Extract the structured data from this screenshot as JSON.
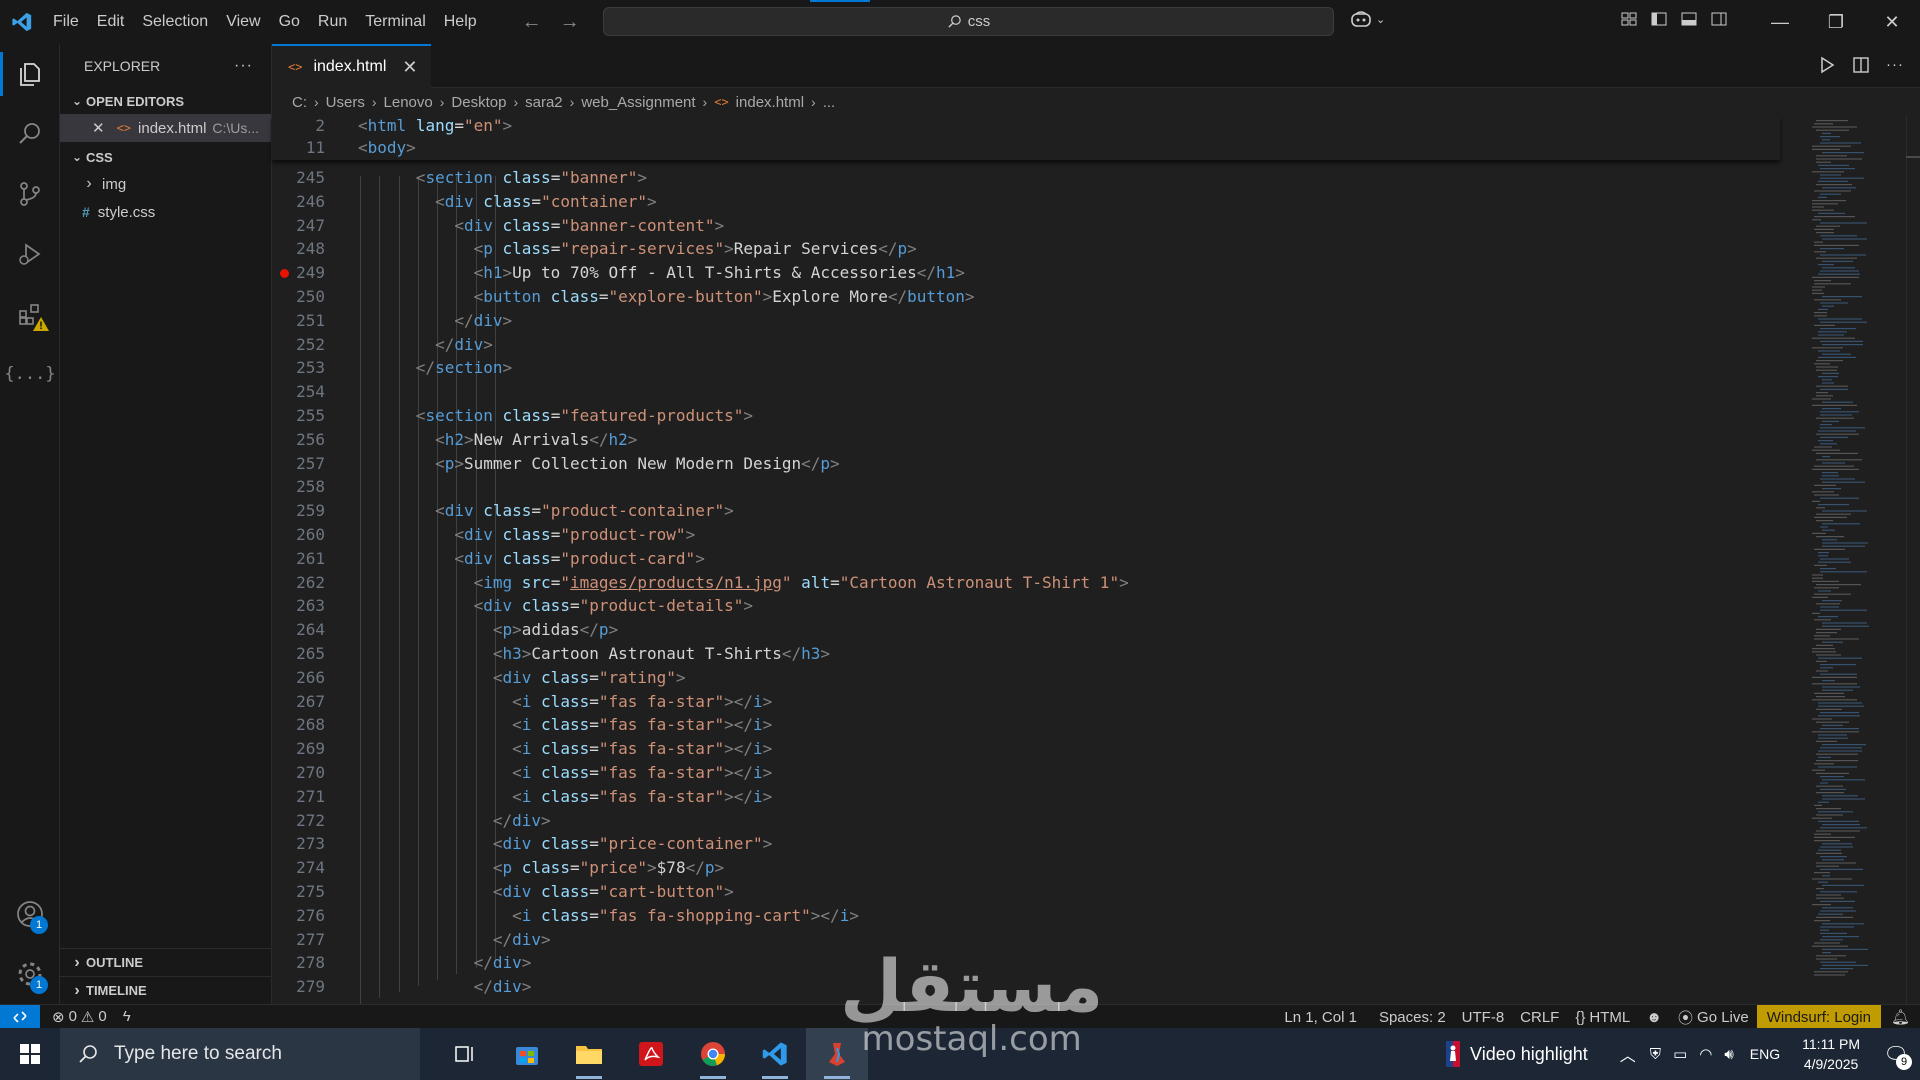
{
  "menu": [
    "File",
    "Edit",
    "Selection",
    "View",
    "Go",
    "Run",
    "Terminal",
    "Help"
  ],
  "command_center": {
    "text": "css"
  },
  "sidebar": {
    "title": "EXPLORER",
    "more": "···",
    "open_editors_label": "OPEN EDITORS",
    "open_editor": {
      "name": "index.html",
      "path": "C:\\Us..."
    },
    "folder_label": "CSS",
    "tree": [
      {
        "name": "img",
        "type": "folder"
      },
      {
        "name": "style.css",
        "type": "css"
      }
    ],
    "outline_label": "OUTLINE",
    "timeline_label": "TIMELINE"
  },
  "tab": {
    "label": "index.html"
  },
  "breadcrumb": [
    "C:",
    "Users",
    "Lenovo",
    "Desktop",
    "sara2",
    "web_Assignment",
    "index.html",
    "..."
  ],
  "sticky_lines": [
    {
      "n": "2",
      "code": "<html lang=\"en\">"
    },
    {
      "n": "11",
      "code": "<body>"
    }
  ],
  "code_lines": [
    {
      "n": "245",
      "code": "      <section class=\"banner\">"
    },
    {
      "n": "246",
      "code": "        <div class=\"container\">"
    },
    {
      "n": "247",
      "code": "          <div class=\"banner-content\">"
    },
    {
      "n": "248",
      "code": "            <p class=\"repair-services\">Repair Services</p>"
    },
    {
      "n": "249",
      "code": "            <h1>Up to 70% Off - All T-Shirts & Accessories</h1>",
      "breakpoint": true
    },
    {
      "n": "250",
      "code": "            <button class=\"explore-button\">Explore More</button>"
    },
    {
      "n": "251",
      "code": "          </div>"
    },
    {
      "n": "252",
      "code": "        </div>"
    },
    {
      "n": "253",
      "code": "      </section>"
    },
    {
      "n": "254",
      "code": ""
    },
    {
      "n": "255",
      "code": "      <section class=\"featured-products\">"
    },
    {
      "n": "256",
      "code": "        <h2>New Arrivals</h2>"
    },
    {
      "n": "257",
      "code": "        <p>Summer Collection New Modern Design</p>"
    },
    {
      "n": "258",
      "code": ""
    },
    {
      "n": "259",
      "code": "        <div class=\"product-container\">"
    },
    {
      "n": "260",
      "code": "          <div class=\"product-row\">"
    },
    {
      "n": "261",
      "code": "          <div class=\"product-card\">"
    },
    {
      "n": "262",
      "code": "            <img src=\"images/products/n1.jpg\" alt=\"Cartoon Astronaut T-Shirt 1\">"
    },
    {
      "n": "263",
      "code": "            <div class=\"product-details\">"
    },
    {
      "n": "264",
      "code": "              <p>adidas</p>"
    },
    {
      "n": "265",
      "code": "              <h3>Cartoon Astronaut T-Shirts</h3>"
    },
    {
      "n": "266",
      "code": "              <div class=\"rating\">"
    },
    {
      "n": "267",
      "code": "                <i class=\"fas fa-star\"></i>"
    },
    {
      "n": "268",
      "code": "                <i class=\"fas fa-star\"></i>"
    },
    {
      "n": "269",
      "code": "                <i class=\"fas fa-star\"></i>"
    },
    {
      "n": "270",
      "code": "                <i class=\"fas fa-star\"></i>"
    },
    {
      "n": "271",
      "code": "                <i class=\"fas fa-star\"></i>"
    },
    {
      "n": "272",
      "code": "              </div>"
    },
    {
      "n": "273",
      "code": "              <div class=\"price-container\">"
    },
    {
      "n": "274",
      "code": "              <p class=\"price\">$78</p>"
    },
    {
      "n": "275",
      "code": "              <div class=\"cart-button\">"
    },
    {
      "n": "276",
      "code": "                <i class=\"fas fa-shopping-cart\"></i>"
    },
    {
      "n": "277",
      "code": "              </div>"
    },
    {
      "n": "278",
      "code": "            </div>"
    },
    {
      "n": "279",
      "code": "            </div>"
    }
  ],
  "status": {
    "errors": "0",
    "warnings": "0",
    "position": "Ln 1, Col 1",
    "spaces": "Spaces: 2",
    "encoding": "UTF-8",
    "eol": "CRLF",
    "language": "HTML",
    "go_live": "Go Live",
    "windsurf": "Windsurf: Login"
  },
  "taskbar": {
    "search_placeholder": "Type here to search",
    "video_highlight": "Video highlight",
    "lang": "ENG",
    "time": "11:11 PM",
    "date": "4/9/2025",
    "notifications": "9"
  },
  "badges": {
    "accounts": "1",
    "settings": "1"
  },
  "watermark": {
    "arabic": "مستقل",
    "latin": "mostaql.com"
  },
  "colors": {
    "accent": "#0078d4",
    "windsurf": "#c19c00",
    "breakpoint": "#e51400"
  }
}
